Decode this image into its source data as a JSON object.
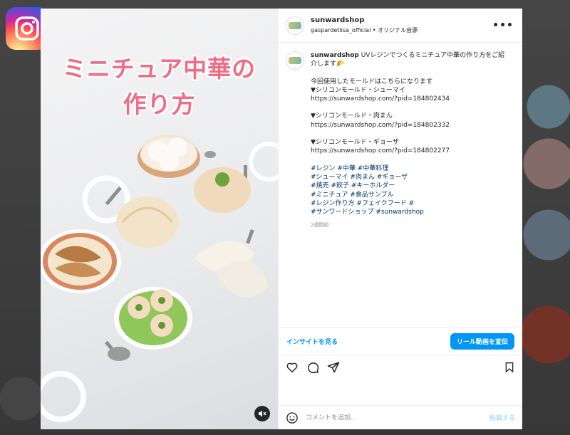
{
  "post": {
    "title_line1": "ミニチュア中華の",
    "title_line2": "作り方"
  },
  "header": {
    "username": "sunwardshop",
    "audio": "gaspardetlisa_official • オリジナル音源"
  },
  "caption": {
    "username": "sunwardshop",
    "intro": "UVレジンでつくるミニチュア中華の作り方をご紹介します🌮",
    "line_used": "今回使用したモールドはこちらになります",
    "item1": "▼シリコンモールド・シューマイ",
    "url1": "https://sunwardshop.com/?pid=184802434",
    "item2": "▼シリコンモールド・肉まん",
    "url2": "https://sunwardshop.com/?pid=184802332",
    "item3": "▼シリコンモールド・ギョーザ",
    "url3": "https://sunwardshop.com/?pid=184802277",
    "hashtags1": "#レジン #中華 #中華料理",
    "hashtags2": "#シューマイ #肉まん #ギョーザ",
    "hashtags3": "#焼売 #餃子 #キーホルダー",
    "hashtags4": "#ミニチュア #食品サンプル",
    "hashtags5": "#レジン作り方 #フェイクフード #",
    "hashtags6": "#サンワードショップ #sunwardshop",
    "time": "2週間前"
  },
  "insight": {
    "link": "インサイトを見る",
    "boost": "リール動画を宣伝"
  },
  "comment": {
    "placeholder": "コメントを追加...",
    "post": "投稿する"
  },
  "icons": [
    "instagram-logo",
    "heart-icon",
    "comment-icon",
    "share-icon",
    "bookmark-icon",
    "mute-icon",
    "more-icon",
    "emoji-icon"
  ]
}
